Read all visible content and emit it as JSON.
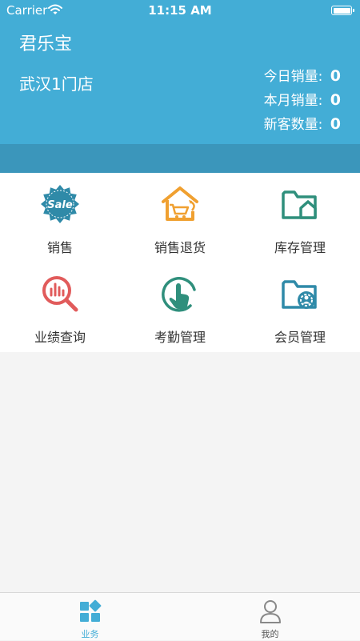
{
  "status_bar": {
    "carrier": "Carrier",
    "time": "11:15 AM"
  },
  "header": {
    "app_name": "君乐宝",
    "store_name": "武汉1门店",
    "stats": [
      {
        "label": "今日销量:",
        "value": "0"
      },
      {
        "label": "本月销量:",
        "value": "0"
      },
      {
        "label": "新客数量:",
        "value": "0"
      }
    ]
  },
  "menu": {
    "items": [
      {
        "label": "销售",
        "icon": "sale-badge-icon"
      },
      {
        "label": "销售退货",
        "icon": "return-cart-icon"
      },
      {
        "label": "库存管理",
        "icon": "folder-house-icon"
      },
      {
        "label": "业绩查询",
        "icon": "search-chart-icon"
      },
      {
        "label": "考勤管理",
        "icon": "tap-hand-icon"
      },
      {
        "label": "会员管理",
        "icon": "folder-gear-icon"
      }
    ],
    "sale_badge_text": "Sale"
  },
  "tabbar": {
    "tabs": [
      {
        "label": "业务",
        "active": true,
        "icon": "grid-icon"
      },
      {
        "label": "我的",
        "active": false,
        "icon": "person-icon"
      }
    ]
  },
  "colors": {
    "header": "#43add6",
    "band": "#3b96bb",
    "active_tab": "#43add6",
    "inactive_tab": "#888888",
    "teal": "#2f8f7c",
    "orange": "#f0a030",
    "red": "#e15b5b"
  }
}
